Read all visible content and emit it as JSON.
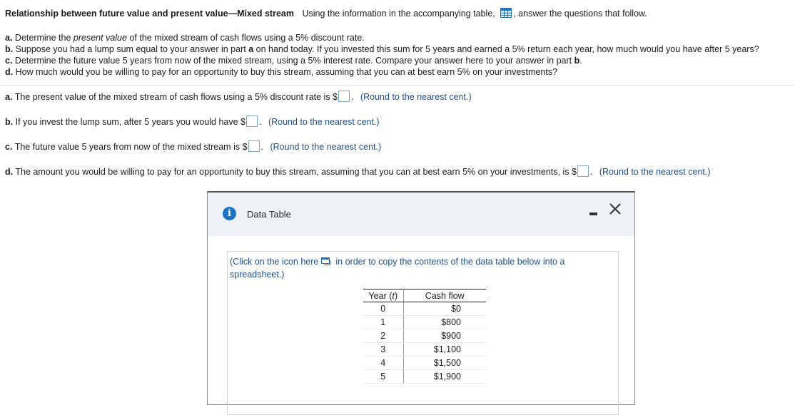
{
  "header": {
    "title": "Relationship between future value and present value—Mixed stream",
    "intro_before": "Using the information in the accompanying table,",
    "intro_after": ", answer the questions that follow."
  },
  "parts": {
    "a": {
      "label": "a.",
      "text_before": "Determine the ",
      "italic": "present value",
      "text_after": " of the mixed stream of cash flows using a 5% discount rate."
    },
    "b": {
      "label": "b.",
      "text": "Suppose you had a lump sum equal to your answer in part ",
      "bold_ref": "a",
      "text_after": " on hand today. If you invested this sum for 5 years and earned a 5% return each year, how much would you have after 5 years?"
    },
    "c": {
      "label": "c.",
      "text": "Determine the future value 5 years from now of the mixed stream, using a 5% interest rate. Compare your answer here to your answer in part ",
      "bold_ref": "b",
      "text_after": "."
    },
    "d": {
      "label": "d.",
      "text": "How much would you be willing to pay for an opportunity to buy this stream, assuming that you can at best earn 5% on your investments?"
    }
  },
  "questions": {
    "a": {
      "label": "a.",
      "text": "The present value of the mixed stream of cash flows using a 5% discount rate is $",
      "hint": "(Round to the nearest cent.)"
    },
    "b": {
      "label": "b.",
      "text": "If you invest the lump sum, after 5 years you would have $",
      "hint": "(Round to the nearest cent.)"
    },
    "c": {
      "label": "c.",
      "text": "The future value 5 years from now of the mixed stream is $",
      "hint": "(Round to the nearest cent.)"
    },
    "d": {
      "label": "d.",
      "text": "The amount you would be willing to pay for an opportunity to buy this stream, assuming that you can at best earn 5% on your investments, is $",
      "hint": "(Round to the nearest cent.)"
    }
  },
  "dialog": {
    "title": "Data Table",
    "copy_note_before": "(Click on the icon here",
    "copy_note_after": "in order to copy the contents of the data table below into a spreadsheet.)",
    "table": {
      "headers": {
        "year": "Year (",
        "year_var": "t",
        "year_close": ")",
        "cash": "Cash flow"
      },
      "rows": [
        {
          "year": "0",
          "cash": "$0"
        },
        {
          "year": "1",
          "cash": "$800"
        },
        {
          "year": "2",
          "cash": "$900"
        },
        {
          "year": "3",
          "cash": "$1,100"
        },
        {
          "year": "4",
          "cash": "$1,500"
        },
        {
          "year": "5",
          "cash": "$1,900"
        }
      ]
    }
  },
  "colors": {
    "accent": "#1a73c6",
    "hint": "#1f4f8a",
    "dialog_header": "#eef1f8"
  }
}
